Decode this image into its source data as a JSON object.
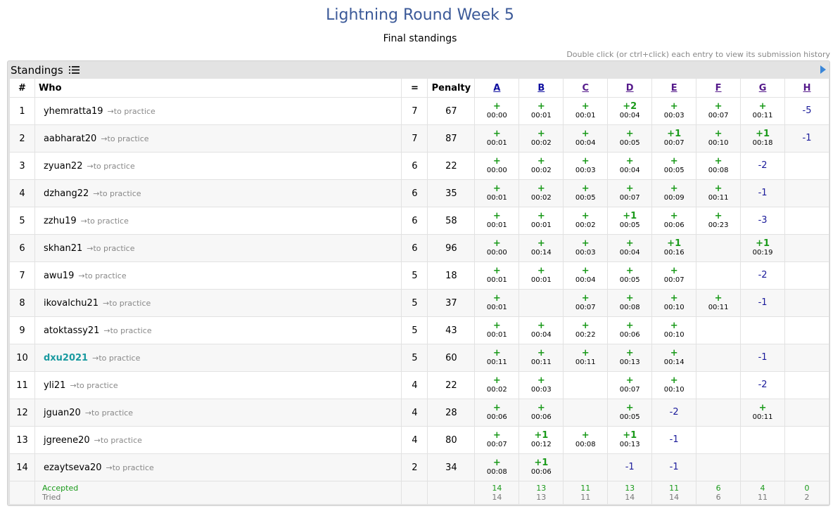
{
  "header": {
    "title": "Lightning Round Week 5",
    "subtitle": "Final standings",
    "hint": "Double click (or ctrl+click) each entry to view its submission history"
  },
  "panel": {
    "title": "Standings",
    "icon": "list-icon",
    "toggle_icon": "triangle-right-icon"
  },
  "columns": {
    "rank": "#",
    "who": "Who",
    "solved": "=",
    "penalty": "Penalty",
    "problems": [
      "A",
      "B",
      "C",
      "D",
      "E",
      "F",
      "G",
      "H"
    ]
  },
  "practice_label": "→to practice",
  "rows": [
    {
      "rank": "1",
      "name": "yhemratta19",
      "solved": "7",
      "penalty": "67",
      "cells": [
        [
          "+",
          "00:00"
        ],
        [
          "+",
          "00:01"
        ],
        [
          "+",
          "00:01"
        ],
        [
          "+2",
          "00:04"
        ],
        [
          "+",
          "00:03"
        ],
        [
          "+",
          "00:07"
        ],
        [
          "+",
          "00:11"
        ],
        [
          "-5",
          ""
        ]
      ]
    },
    {
      "rank": "2",
      "name": "aabharat20",
      "solved": "7",
      "penalty": "87",
      "cells": [
        [
          "+",
          "00:01"
        ],
        [
          "+",
          "00:02"
        ],
        [
          "+",
          "00:04"
        ],
        [
          "+",
          "00:05"
        ],
        [
          "+1",
          "00:07"
        ],
        [
          "+",
          "00:10"
        ],
        [
          "+1",
          "00:18"
        ],
        [
          "-1",
          ""
        ]
      ]
    },
    {
      "rank": "3",
      "name": "zyuan22",
      "solved": "6",
      "penalty": "22",
      "cells": [
        [
          "+",
          "00:00"
        ],
        [
          "+",
          "00:02"
        ],
        [
          "+",
          "00:03"
        ],
        [
          "+",
          "00:04"
        ],
        [
          "+",
          "00:05"
        ],
        [
          "+",
          "00:08"
        ],
        [
          "-2",
          ""
        ],
        [
          "",
          ""
        ]
      ]
    },
    {
      "rank": "4",
      "name": "dzhang22",
      "solved": "6",
      "penalty": "35",
      "cells": [
        [
          "+",
          "00:01"
        ],
        [
          "+",
          "00:02"
        ],
        [
          "+",
          "00:05"
        ],
        [
          "+",
          "00:07"
        ],
        [
          "+",
          "00:09"
        ],
        [
          "+",
          "00:11"
        ],
        [
          "-1",
          ""
        ],
        [
          "",
          ""
        ]
      ]
    },
    {
      "rank": "5",
      "name": "zzhu19",
      "solved": "6",
      "penalty": "58",
      "cells": [
        [
          "+",
          "00:01"
        ],
        [
          "+",
          "00:01"
        ],
        [
          "+",
          "00:02"
        ],
        [
          "+1",
          "00:05"
        ],
        [
          "+",
          "00:06"
        ],
        [
          "+",
          "00:23"
        ],
        [
          "-3",
          ""
        ],
        [
          "",
          ""
        ]
      ]
    },
    {
      "rank": "6",
      "name": "skhan21",
      "solved": "6",
      "penalty": "96",
      "cells": [
        [
          "+",
          "00:00"
        ],
        [
          "+",
          "00:14"
        ],
        [
          "+",
          "00:03"
        ],
        [
          "+",
          "00:04"
        ],
        [
          "+1",
          "00:16"
        ],
        [
          "",
          ""
        ],
        [
          "+1",
          "00:19"
        ],
        [
          "",
          ""
        ]
      ]
    },
    {
      "rank": "7",
      "name": "awu19",
      "solved": "5",
      "penalty": "18",
      "cells": [
        [
          "+",
          "00:01"
        ],
        [
          "+",
          "00:01"
        ],
        [
          "+",
          "00:04"
        ],
        [
          "+",
          "00:05"
        ],
        [
          "+",
          "00:07"
        ],
        [
          "",
          ""
        ],
        [
          "-2",
          ""
        ],
        [
          "",
          ""
        ]
      ]
    },
    {
      "rank": "8",
      "name": "ikovalchu21",
      "solved": "5",
      "penalty": "37",
      "cells": [
        [
          "+",
          "00:01"
        ],
        [
          "",
          ""
        ],
        [
          "+",
          "00:07"
        ],
        [
          "+",
          "00:08"
        ],
        [
          "+",
          "00:10"
        ],
        [
          "+",
          "00:11"
        ],
        [
          "-1",
          ""
        ],
        [
          "",
          ""
        ]
      ]
    },
    {
      "rank": "9",
      "name": "atoktassy21",
      "solved": "5",
      "penalty": "43",
      "cells": [
        [
          "+",
          "00:01"
        ],
        [
          "+",
          "00:04"
        ],
        [
          "+",
          "00:22"
        ],
        [
          "+",
          "00:06"
        ],
        [
          "+",
          "00:10"
        ],
        [
          "",
          ""
        ],
        [
          "",
          ""
        ],
        [
          "",
          ""
        ]
      ]
    },
    {
      "rank": "10",
      "name": "dxu2021",
      "me": true,
      "solved": "5",
      "penalty": "60",
      "cells": [
        [
          "+",
          "00:11"
        ],
        [
          "+",
          "00:11"
        ],
        [
          "+",
          "00:11"
        ],
        [
          "+",
          "00:13"
        ],
        [
          "+",
          "00:14"
        ],
        [
          "",
          ""
        ],
        [
          "-1",
          ""
        ],
        [
          "",
          ""
        ]
      ]
    },
    {
      "rank": "11",
      "name": "yli21",
      "solved": "4",
      "penalty": "22",
      "cells": [
        [
          "+",
          "00:02"
        ],
        [
          "+",
          "00:03"
        ],
        [
          "",
          ""
        ],
        [
          "+",
          "00:07"
        ],
        [
          "+",
          "00:10"
        ],
        [
          "",
          ""
        ],
        [
          "-2",
          ""
        ],
        [
          "",
          ""
        ]
      ]
    },
    {
      "rank": "12",
      "name": "jguan20",
      "solved": "4",
      "penalty": "28",
      "cells": [
        [
          "+",
          "00:06"
        ],
        [
          "+",
          "00:06"
        ],
        [
          "",
          ""
        ],
        [
          "+",
          "00:05"
        ],
        [
          "-2",
          ""
        ],
        [
          "",
          ""
        ],
        [
          "+",
          "00:11"
        ],
        [
          "",
          ""
        ]
      ]
    },
    {
      "rank": "13",
      "name": "jgreene20",
      "solved": "4",
      "penalty": "80",
      "cells": [
        [
          "+",
          "00:07"
        ],
        [
          "+1",
          "00:12"
        ],
        [
          "+",
          "00:08"
        ],
        [
          "+1",
          "00:13"
        ],
        [
          "-1",
          ""
        ],
        [
          "",
          ""
        ],
        [
          "",
          ""
        ],
        [
          "",
          ""
        ]
      ]
    },
    {
      "rank": "14",
      "name": "ezaytseva20",
      "solved": "2",
      "penalty": "34",
      "cells": [
        [
          "+",
          "00:08"
        ],
        [
          "+1",
          "00:06"
        ],
        [
          "",
          ""
        ],
        [
          "-1",
          ""
        ],
        [
          "-1",
          ""
        ],
        [
          "",
          ""
        ],
        [
          "",
          ""
        ],
        [
          "",
          ""
        ]
      ]
    }
  ],
  "footer": {
    "accepted_label": "Accepted",
    "tried_label": "Tried",
    "accepted": [
      "14",
      "13",
      "11",
      "13",
      "11",
      "6",
      "4",
      "0"
    ],
    "tried": [
      "14",
      "13",
      "11",
      "14",
      "14",
      "6",
      "11",
      "2"
    ]
  },
  "colors": {
    "accepted": "#1a9a1a",
    "rejected": "#1a1a9a",
    "highlight_user": "#1a9aa0",
    "title": "#3b5998"
  }
}
